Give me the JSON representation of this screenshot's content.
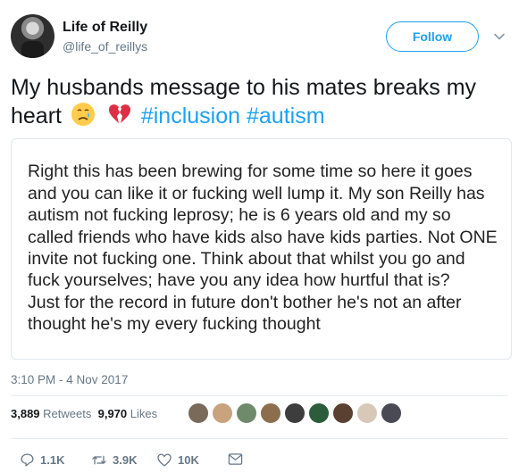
{
  "user": {
    "name": "Life of Reilly",
    "handle": "@life_of_reillys"
  },
  "follow_label": "Follow",
  "tweet": {
    "text_main": "My husbands message to his mates  breaks my heart",
    "emojis": [
      "crying-face",
      "broken-heart"
    ],
    "hashtags": [
      "#inclusion",
      "#autism"
    ]
  },
  "image_text": "Right this has been brewing for some time so here it goes and you can like it or fucking well lump it. My son Reilly has autism not fucking leprosy; he is 6 years old and my so called friends who have kids also have kids parties. Not ONE invite not fucking one. Think about that whilst you go and fuck yourselves; have you any idea how hurtful that is?\nJust for the record in future don't bother he's not an after thought he's my every fucking thought",
  "timestamp": "3:10 PM - 4 Nov 2017",
  "stats": {
    "retweets_count": "3,889",
    "retweets_label": "Retweets",
    "likes_count": "9,970",
    "likes_label": "Likes"
  },
  "liker_colors": [
    "#7a6a5a",
    "#c9a27e",
    "#6f8a6b",
    "#8c6e4f",
    "#3d3d3d",
    "#2b5d3a",
    "#5a4030",
    "#d8c8b8",
    "#4a4a55"
  ],
  "actions": {
    "reply": "1.1K",
    "retweet": "3.9K",
    "like": "10K"
  },
  "colors": {
    "accent": "#1da1f2",
    "muted": "#657786"
  }
}
